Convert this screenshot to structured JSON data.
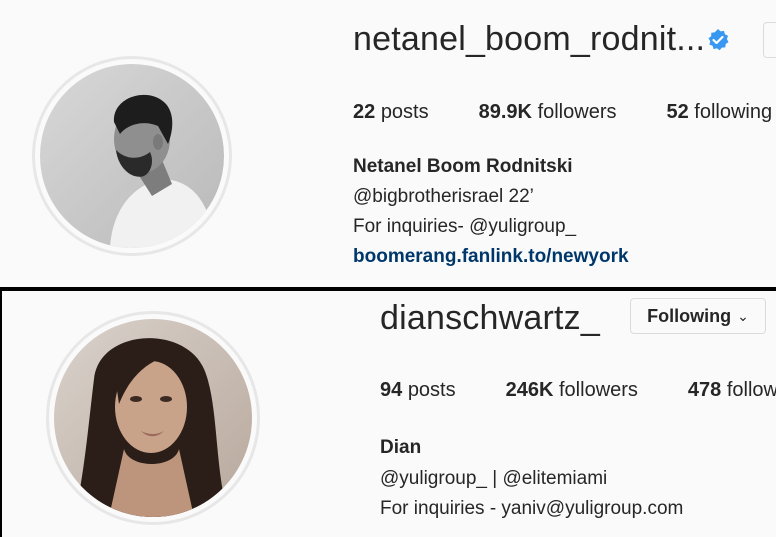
{
  "profiles": [
    {
      "username": "netanel_boom_rodnit...",
      "verified": true,
      "stats": [
        {
          "count": "22",
          "label": "posts"
        },
        {
          "count": "89.9K",
          "label": "followers"
        },
        {
          "count": "52",
          "label": "following"
        }
      ],
      "bio": {
        "name": "Netanel Boom Rodnitski",
        "line1": "@bigbrotherisrael 22’",
        "line2": "For inquiries- @yuligroup_",
        "link": "boomerang.fanlink.to/newyork"
      },
      "avatar_icon": "profile-photo-grayscale-man"
    },
    {
      "username": "dianschwartz_",
      "verified": false,
      "follow_button": "Following",
      "stats": [
        {
          "count": "94",
          "label": "posts"
        },
        {
          "count": "246K",
          "label": "followers"
        },
        {
          "count": "478",
          "label": "following"
        }
      ],
      "bio": {
        "name": "Dian",
        "line1": "@yuligroup_ | @elitemiami",
        "line2": "For inquiries - yaniv@yuligroup.com"
      },
      "avatar_icon": "profile-photo-woman"
    }
  ],
  "colors": {
    "background": "#fafafa",
    "text": "#262626",
    "link": "#00376b",
    "verified_badge": "#3897f0",
    "border": "#dbdbdb"
  }
}
